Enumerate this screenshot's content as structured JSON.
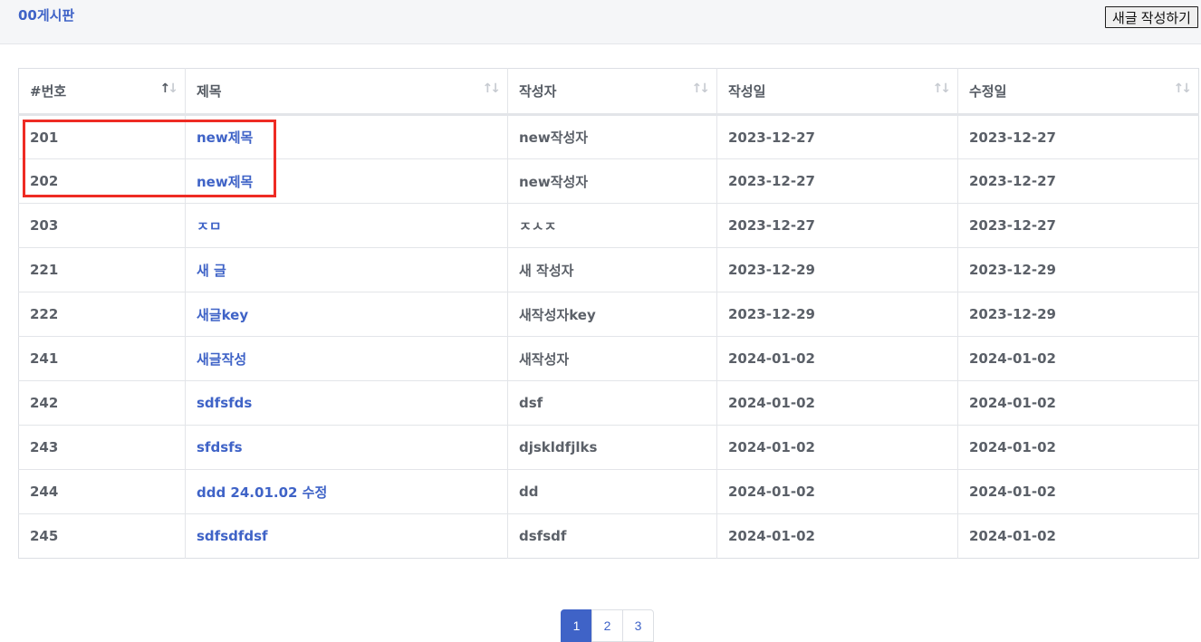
{
  "header": {
    "board_title": "00게시판",
    "write_button": "새글 작성하기"
  },
  "table": {
    "columns": [
      {
        "label": "#번호",
        "sort_active": true
      },
      {
        "label": "제목",
        "sort_active": false
      },
      {
        "label": "작성자",
        "sort_active": false
      },
      {
        "label": "작성일",
        "sort_active": false
      },
      {
        "label": "수정일",
        "sort_active": false
      }
    ],
    "rows": [
      {
        "no": "201",
        "title": "new제목",
        "author": "new작성자",
        "created": "2023-12-27",
        "updated": "2023-12-27"
      },
      {
        "no": "202",
        "title": "new제목",
        "author": "new작성자",
        "created": "2023-12-27",
        "updated": "2023-12-27"
      },
      {
        "no": "203",
        "title": "ㅈㅁ",
        "author": "ㅈㅅㅈ",
        "created": "2023-12-27",
        "updated": "2023-12-27"
      },
      {
        "no": "221",
        "title": "새 글",
        "author": "새 작성자",
        "created": "2023-12-29",
        "updated": "2023-12-29"
      },
      {
        "no": "222",
        "title": "새글key",
        "author": "새작성자key",
        "created": "2023-12-29",
        "updated": "2023-12-29"
      },
      {
        "no": "241",
        "title": "새글작성",
        "author": "새작성자",
        "created": "2024-01-02",
        "updated": "2024-01-02"
      },
      {
        "no": "242",
        "title": "sdfsfds",
        "author": "dsf",
        "created": "2024-01-02",
        "updated": "2024-01-02"
      },
      {
        "no": "243",
        "title": "sfdsfs",
        "author": "djskldfjlks",
        "created": "2024-01-02",
        "updated": "2024-01-02"
      },
      {
        "no": "244",
        "title": "ddd 24.01.02 수정",
        "author": "dd",
        "created": "2024-01-02",
        "updated": "2024-01-02"
      },
      {
        "no": "245",
        "title": "sdfsdfdsf",
        "author": "dsfsdf",
        "created": "2024-01-02",
        "updated": "2024-01-02"
      }
    ]
  },
  "pagination": {
    "pages": [
      "1",
      "2",
      "3"
    ],
    "current": "1"
  },
  "colors": {
    "accent": "#3f63c7",
    "highlight_box": "#ee2b24"
  },
  "icons": {
    "sort": "sort-arrows-icon"
  }
}
